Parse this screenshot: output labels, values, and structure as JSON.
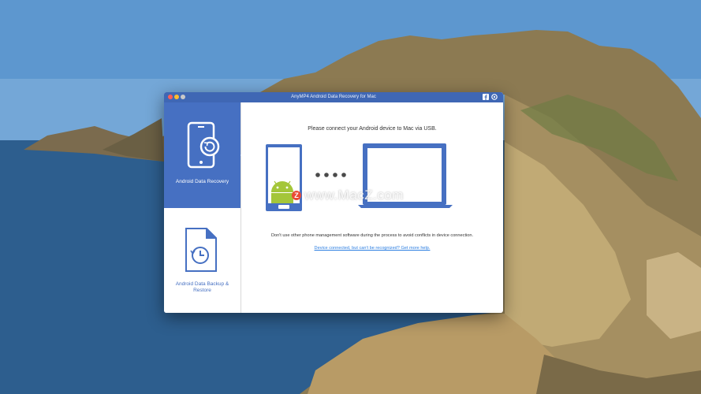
{
  "window": {
    "title": "AnyMP4 Android Data Recovery for Mac"
  },
  "sidebar": {
    "items": [
      {
        "label": "Android Data Recovery",
        "active": true
      },
      {
        "label": "Android Data Backup & Restore",
        "active": false
      }
    ]
  },
  "main": {
    "connect_text": "Please connect your Android device to Mac via USB.",
    "warning_text": "Don't use other phone management software during the process to avoid conflicts in device connection.",
    "help_link": "Device connected, but can't be recognized? Get more help."
  },
  "watermark": {
    "badge": "Z",
    "text": "www.MacZ.com"
  },
  "colors": {
    "accent": "#4670c2",
    "titlebar": "#3f67b4",
    "link": "#2a7de1",
    "android_green": "#a4c639"
  }
}
